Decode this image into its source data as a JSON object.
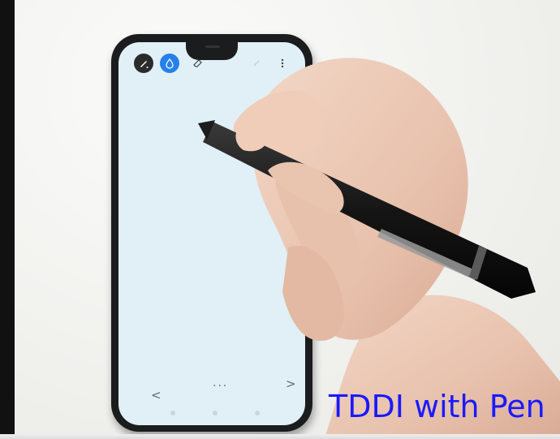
{
  "overlay": {
    "caption": "TDDI with Pen"
  },
  "app": {
    "toolbar": {
      "pen_icon": "pen-icon",
      "ink_icon": "ink-drop-icon",
      "eraser_icon": "eraser-icon",
      "undo_icon": "undo-icon",
      "menu_icon": "more-vertical-icon"
    },
    "nav": {
      "back": "<",
      "more": "...",
      "forward": ">"
    }
  },
  "colors": {
    "caption": "#1a1aff",
    "screen": "#e1f0f7",
    "active_tool": "#2680e8"
  }
}
